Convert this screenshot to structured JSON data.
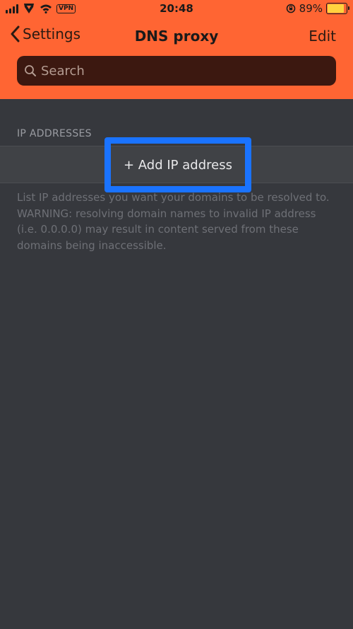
{
  "status_bar": {
    "time": "20:48",
    "vpn_label": "VPN",
    "battery_percent": "89%",
    "battery_level": 0.89,
    "icons": [
      "cellular-signal-icon",
      "carrier-logo-icon",
      "wifi-icon",
      "rotation-lock-icon",
      "battery-icon"
    ]
  },
  "nav": {
    "back_label": "Settings",
    "title": "DNS proxy",
    "edit_label": "Edit"
  },
  "search": {
    "placeholder": "Search"
  },
  "ip_section": {
    "header": "IP ADDRESSES",
    "add_label": "+ Add IP address",
    "footer": "List IP addresses you want your domains to be resolved to. WARNING: resolving domain names to invalid IP address (i.e. 0.0.0.0) may result in content served from these domains being inaccessible."
  },
  "colors": {
    "accent": "#ff6533",
    "background": "#36383d",
    "highlight": "#1a73ff"
  }
}
